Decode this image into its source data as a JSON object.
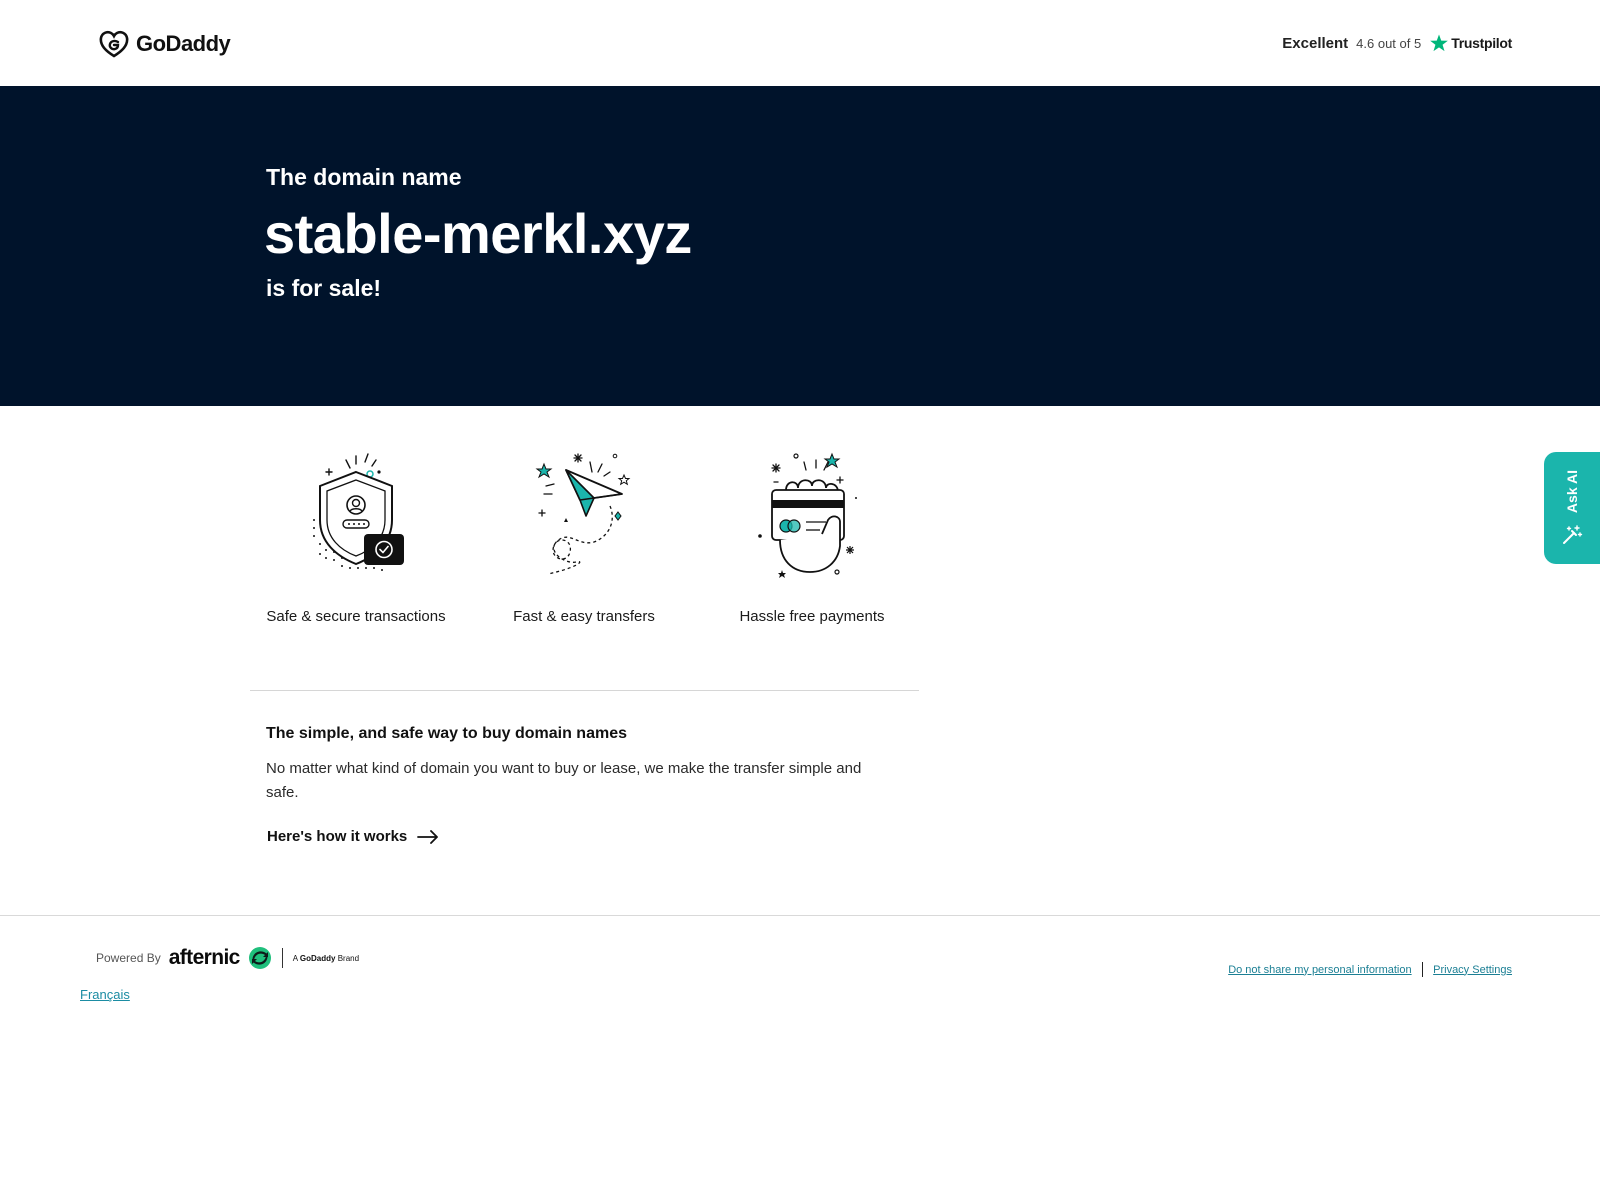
{
  "header": {
    "logo_text": "GoDaddy",
    "trustpilot": {
      "rating_word": "Excellent",
      "rating_text": "4.6 out of 5",
      "brand": "Trustpilot"
    }
  },
  "hero": {
    "pre": "The domain name",
    "domain": "stable-merkl.xyz",
    "post": "is for sale!"
  },
  "features": [
    {
      "label": "Safe & secure transactions",
      "icon": "shield-icon"
    },
    {
      "label": "Fast & easy transfers",
      "icon": "paper-plane-icon"
    },
    {
      "label": "Hassle free payments",
      "icon": "credit-card-hand-icon"
    }
  ],
  "info": {
    "title": "The simple, and safe way to buy domain names",
    "body": "No matter what kind of domain you want to buy or lease, we make the transfer simple and safe.",
    "link": "Here's how it works"
  },
  "ask_ai": {
    "label": "Ask AI"
  },
  "footer": {
    "powered_by": "Powered By",
    "brand": "afternic",
    "brand_sub_prefix": "A",
    "brand_sub_name": "GoDaddy",
    "brand_sub_suffix": "Brand",
    "language": "Français",
    "links": {
      "do_not_share": "Do not share my personal information",
      "privacy": "Privacy Settings"
    }
  },
  "colors": {
    "hero_bg": "#00132b",
    "accent_teal": "#1bb5ac",
    "trustpilot_green": "#00b67a",
    "link_teal": "#1b7f94"
  }
}
